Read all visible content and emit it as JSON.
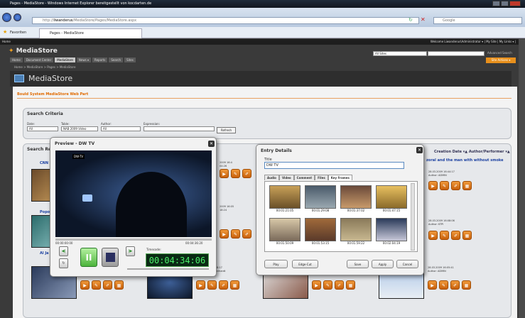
{
  "window": {
    "title": "Pages - MediaStore - Windows Internet Explorer bereitgestellt von kocdarten.de"
  },
  "browser": {
    "url_host": "liwanderus",
    "url_path": "/MediaStore/Pages/MediaStore.aspx",
    "url_prefix": "http://",
    "search_placeholder": "Google",
    "fav_label": "Favoriten",
    "tab_label": "Pages - MediaStore"
  },
  "sharepoint": {
    "home": "Home",
    "welcome": "Welcome Liwanderus\\Administrator ▾ | My Site | My Links ▾ |",
    "site_name": "MediaStore",
    "nav": [
      "Home",
      "Document Center",
      "MediaStore",
      "News ▾",
      "Reports",
      "Search",
      "Sites"
    ],
    "nav_active": 2,
    "scope": "All Sites",
    "advanced": "Advanced Search",
    "site_actions": "Site Actions ▾",
    "breadcrumb": "Home > MediaStore > Pages > MediaStore",
    "page_title": "MediaStore"
  },
  "webpart": {
    "title": "Bould System MediaStore Web Part"
  },
  "criteria": {
    "title": "Search Criteria",
    "date_label": "Date:",
    "date_value": "All",
    "table_label": "Table:",
    "table_value": "NAB 2009 Video",
    "author_label": "Author:",
    "author_value": "All",
    "expression_label": "Expression:",
    "expression_value": "",
    "refresh": "Refresh"
  },
  "results": {
    "title": "Search Re",
    "sort_header": "Creation Date ▾▲  Author/Performer ▾▲",
    "top_left": "CNN",
    "top_right_title": "zoral and the man with without smoke",
    "top_right_meta": [
      "28.03.2009 16:44:17",
      "Author: ADMIN"
    ],
    "mid_left": "Popo",
    "mid_right_meta": [
      "28.03.2009 16:08:06",
      "Author: KTPI"
    ],
    "left_frag": "Al Ja",
    "hidden_meta_a": [
      "2009 16:4",
      "04:26"
    ],
    "hidden_meta_b": [
      "2009 16:05",
      "18:24"
    ],
    "row3": [
      {
        "meta": [
          "28.03.2009 16:08:11",
          "Author: Al Jazeera"
        ]
      },
      {
        "meta": [
          "28.03.2009 16:08:17",
          "Author: Volker Gerhardt"
        ]
      },
      {
        "meta": [
          "28.03.2009 16:05:16",
          "Author: Eric Jones"
        ]
      },
      {
        "meta": [
          "28.03.2009 16:05:41",
          "Author: ADMIN"
        ]
      }
    ]
  },
  "preview": {
    "title": "Preview - DW TV",
    "logo": "DW-TV",
    "time_start": "00:00:00:00",
    "time_end": "00:04:36:20",
    "timecode_label": "Timecode:",
    "timecode": "00:04:34:06"
  },
  "entry": {
    "title": "Entry Details",
    "field_label": "Title",
    "field_value": "DW TV",
    "tabs": [
      "Audio",
      "Video",
      "Comment",
      "Files",
      "Key Frames"
    ],
    "active_tab": 4,
    "keyframes": [
      "00:01:21:05",
      "00:01:29:08",
      "00:01:37:02",
      "00:01:47:15",
      "00:01:50:09",
      "00:01:53:15",
      "00:01:59:22",
      "00:02:04:19"
    ],
    "play": "Play",
    "edge_cut": "Edge-Cut",
    "save": "Save",
    "apply": "Apply",
    "cancel": "Cancel"
  },
  "colors": {
    "accent": "#e8901c",
    "link": "#1a3fa0",
    "timecode": "#4cf06a"
  }
}
